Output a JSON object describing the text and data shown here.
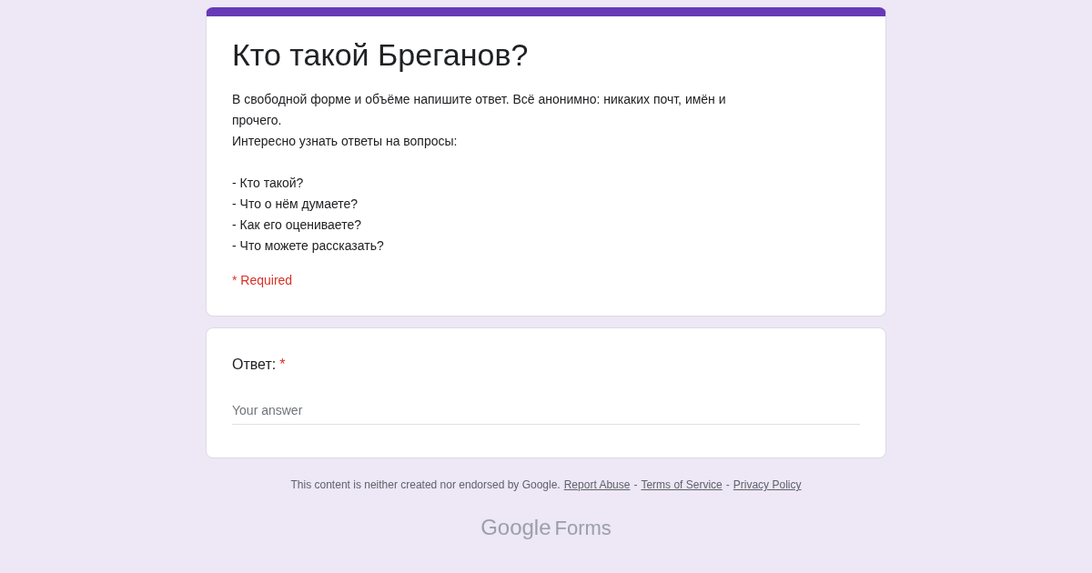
{
  "header_card": {
    "title": "Кто такой Бреганов?",
    "description": {
      "paragraphs": [
        "В свободной форме и объёме напишите ответ. Всё анонимно: никаких почт, имён и прочего.",
        "Интересно узнать ответы на вопросы:"
      ],
      "list_items": [
        "- Кто такой?",
        "- Что о нём думаете?",
        "- Как его оцениваете?",
        "- Что можете рассказать?"
      ]
    },
    "required_note": "* Required"
  },
  "question": {
    "label": "Ответ:",
    "required_mark": "*",
    "placeholder": "Your answer"
  },
  "footer": {
    "disclaimer": "This content is neither created nor endorsed by Google.",
    "links": [
      {
        "label": "Report Abuse"
      },
      {
        "label": "Terms of Service"
      },
      {
        "label": "Privacy Policy"
      }
    ],
    "separators": [
      "-",
      "-"
    ]
  },
  "logo": {
    "brand": "Google",
    "product": "Forms"
  }
}
